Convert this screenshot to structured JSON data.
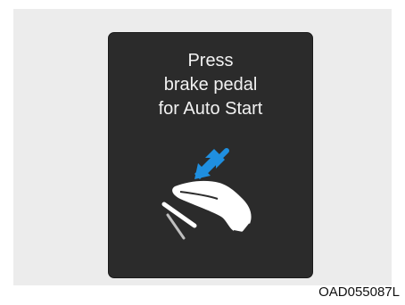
{
  "display": {
    "message_lines": [
      "Press",
      "brake pedal",
      "for Auto Start"
    ]
  },
  "icons": {
    "arrow": "down-left-arrow-icon",
    "foot": "foot-on-brake-pedal-icon"
  },
  "colors": {
    "panel_background": "#ececec",
    "screen_background": "#2b2b2b",
    "text": "#f2f2f2",
    "arrow_blue": "#1f8fe0"
  },
  "caption": "OAD055087L"
}
